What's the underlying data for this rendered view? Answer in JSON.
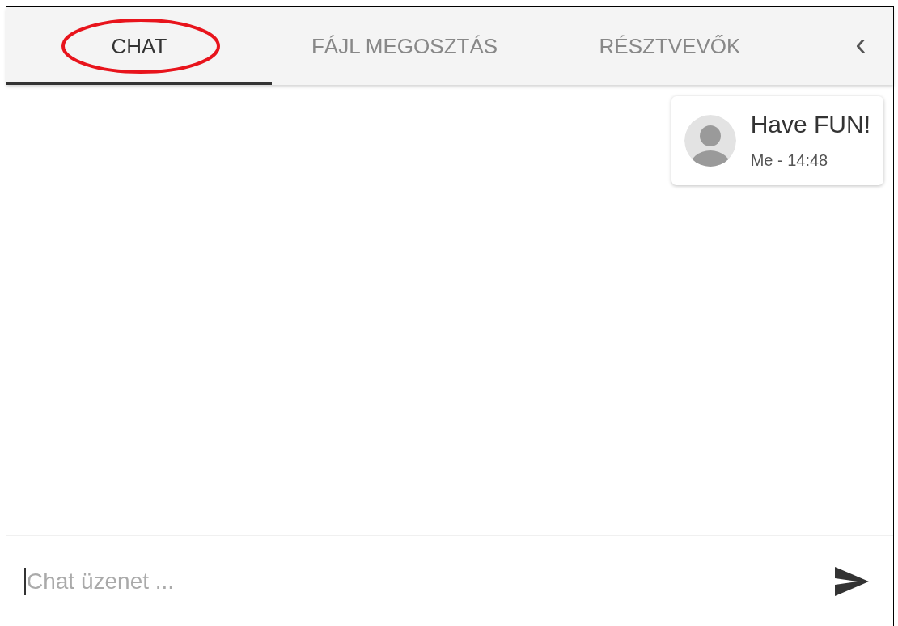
{
  "tabs": [
    {
      "label": "CHAT",
      "selected": true
    },
    {
      "label": "FÁJL MEGOSZTÁS",
      "selected": false
    },
    {
      "label": "RÉSZTVEVŐK",
      "selected": false
    }
  ],
  "collapse_button": {
    "label": "‹"
  },
  "messages": [
    {
      "text": "Have FUN!",
      "meta": "Me - 14:48"
    }
  ],
  "composer": {
    "placeholder": "Chat üzenet ..."
  }
}
